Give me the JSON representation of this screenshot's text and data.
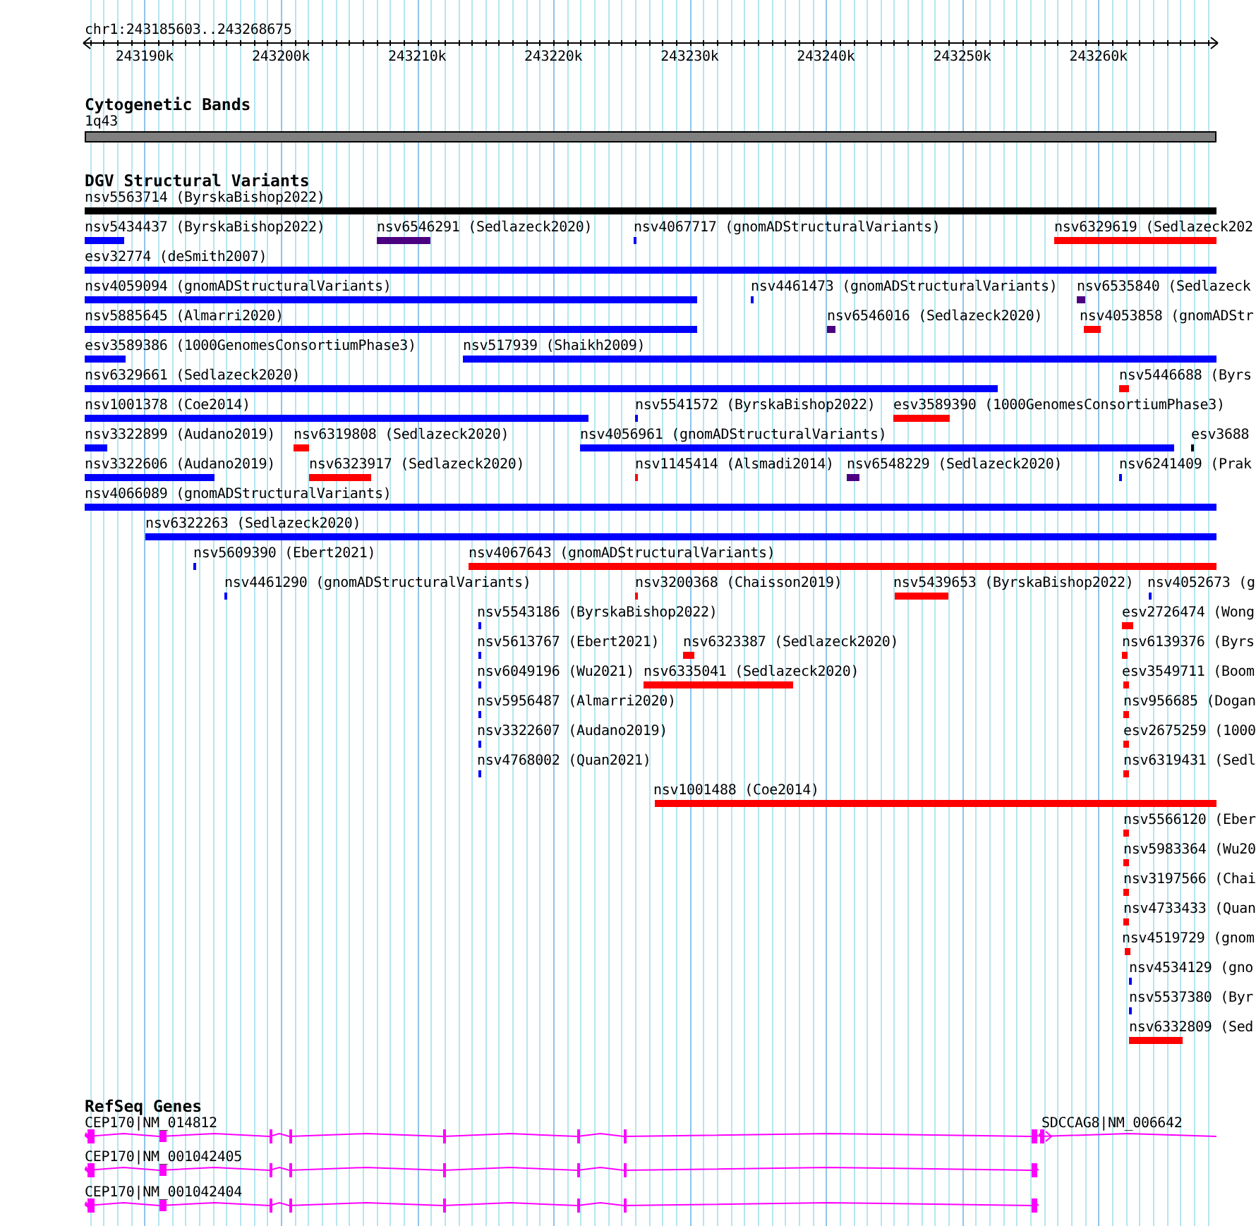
{
  "ruler": {
    "location": "chr1:243185603..243268675",
    "tick_labels": [
      "243190k",
      "243200k",
      "243210k",
      "243220k",
      "243230k",
      "243240k",
      "243250k",
      "243260k"
    ]
  },
  "cytogenetic_bands": {
    "title": "Cytogenetic Bands",
    "band": "1q43"
  },
  "dgv_structural_variants": {
    "title": "DGV Structural Variants",
    "variants": [
      {
        "label": "nsv5563714 (ByrskaBishop2022)",
        "color": "#000000"
      },
      {
        "label": "nsv5434437 (ByrskaBishop2022)",
        "color": "#0000ff"
      },
      {
        "label": "nsv6546291 (Sedlazeck2020)",
        "color": "#4b0082"
      },
      {
        "label": "nsv4067717 (gnomADStructuralVariants)",
        "color": "#0000ff"
      },
      {
        "label": "nsv6329619 (Sedlazeck202",
        "color": "#ff0000"
      },
      {
        "label": "esv32774 (deSmith2007)",
        "color": "#0000ff"
      },
      {
        "label": "nsv4059094 (gnomADStructuralVariants)",
        "color": "#0000ff"
      },
      {
        "label": "nsv4461473 (gnomADStructuralVariants)",
        "color": "#0000ff"
      },
      {
        "label": "nsv6535840 (Sedlazeck",
        "color": "#4b0082"
      },
      {
        "label": "nsv5885645 (Almarri2020)",
        "color": "#0000ff"
      },
      {
        "label": "nsv6546016 (Sedlazeck2020)",
        "color": "#4b0082"
      },
      {
        "label": "nsv4053858 (gnomADStr",
        "color": "#ff0000"
      },
      {
        "label": "esv3589386 (1000GenomesConsortiumPhase3)",
        "color": "#0000ff"
      },
      {
        "label": "nsv517939 (Shaikh2009)",
        "color": "#0000ff"
      },
      {
        "label": "nsv6329661 (Sedlazeck2020)",
        "color": "#0000ff"
      },
      {
        "label": "nsv5446688 (Byrs",
        "color": "#ff0000"
      },
      {
        "label": "nsv1001378 (Coe2014)",
        "color": "#0000ff"
      },
      {
        "label": "nsv5541572 (ByrskaBishop2022)",
        "color": "#0000ff"
      },
      {
        "label": "esv3589390 (1000GenomesConsortiumPhase3)",
        "color": "#ff0000"
      },
      {
        "label": "nsv3322899 (Audano2019)",
        "color": "#0000ff"
      },
      {
        "label": "nsv6319808 (Sedlazeck2020)",
        "color": "#ff0000"
      },
      {
        "label": "nsv4056961 (gnomADStructuralVariants)",
        "color": "#0000ff"
      },
      {
        "label": "esv3688",
        "color": "#000000"
      },
      {
        "label": "nsv3322606 (Audano2019)",
        "color": "#0000ff"
      },
      {
        "label": "nsv6323917 (Sedlazeck2020)",
        "color": "#ff0000"
      },
      {
        "label": "nsv1145414 (Alsmadi2014)",
        "color": "#ff0000"
      },
      {
        "label": "nsv6548229 (Sedlazeck2020)",
        "color": "#4b0082"
      },
      {
        "label": "nsv6241409 (Prak",
        "color": "#0000ff"
      },
      {
        "label": "nsv4066089 (gnomADStructuralVariants)",
        "color": "#0000ff"
      },
      {
        "label": "nsv6322263 (Sedlazeck2020)",
        "color": "#0000ff"
      },
      {
        "label": "nsv5609390 (Ebert2021)",
        "color": "#0000ff"
      },
      {
        "label": "nsv4067643 (gnomADStructuralVariants)",
        "color": "#ff0000"
      },
      {
        "label": "nsv4461290 (gnomADStructuralVariants)",
        "color": "#0000ff"
      },
      {
        "label": "nsv3200368 (Chaisson2019)",
        "color": "#ff0000"
      },
      {
        "label": "nsv5439653 (ByrskaBishop2022)",
        "color": "#ff0000"
      },
      {
        "label": "nsv4052673 (g",
        "color": "#0000ff"
      },
      {
        "label": "nsv5543186 (ByrskaBishop2022)",
        "color": "#0000ff"
      },
      {
        "label": "esv2726474 (Wong",
        "color": "#ff0000"
      },
      {
        "label": "nsv5613767 (Ebert2021)",
        "color": "#0000ff"
      },
      {
        "label": "nsv6323387 (Sedlazeck2020)",
        "color": "#ff0000"
      },
      {
        "label": "nsv6139376 (Byrs",
        "color": "#ff0000"
      },
      {
        "label": "nsv6049196 (Wu2021)",
        "color": "#0000ff"
      },
      {
        "label": "nsv6335041 (Sedlazeck2020)",
        "color": "#ff0000"
      },
      {
        "label": "esv3549711 (Boom",
        "color": "#ff0000"
      },
      {
        "label": "nsv5956487 (Almarri2020)",
        "color": "#0000ff"
      },
      {
        "label": "nsv956685 (Dogan",
        "color": "#ff0000"
      },
      {
        "label": "nsv3322607 (Audano2019)",
        "color": "#0000ff"
      },
      {
        "label": "esv2675259 (1000",
        "color": "#ff0000"
      },
      {
        "label": "nsv4768002 (Quan2021)",
        "color": "#0000ff"
      },
      {
        "label": "nsv6319431 (Sedl",
        "color": "#ff0000"
      },
      {
        "label": "nsv1001488 (Coe2014)",
        "color": "#ff0000"
      },
      {
        "label": "nsv5566120 (Eber",
        "color": "#ff0000"
      },
      {
        "label": "nsv5983364 (Wu20",
        "color": "#ff0000"
      },
      {
        "label": "nsv3197566 (Chai",
        "color": "#ff0000"
      },
      {
        "label": "nsv4733433 (Quan",
        "color": "#ff0000"
      },
      {
        "label": "nsv4519729 (gnom",
        "color": "#ff0000"
      },
      {
        "label": "nsv4534129 (gno",
        "color": "#0000ff"
      },
      {
        "label": "nsv5537380 (Byr",
        "color": "#0000ff"
      },
      {
        "label": "nsv6332809 (Sed",
        "color": "#ff0000"
      }
    ]
  },
  "refseq_genes": {
    "title": "RefSeq Genes",
    "transcripts": [
      {
        "label": "CEP170|NM_014812"
      },
      {
        "label": "SDCCAG8|NM_006642"
      },
      {
        "label": "CEP170|NM_001042405"
      },
      {
        "label": "CEP170|NM_001042404"
      }
    ]
  }
}
